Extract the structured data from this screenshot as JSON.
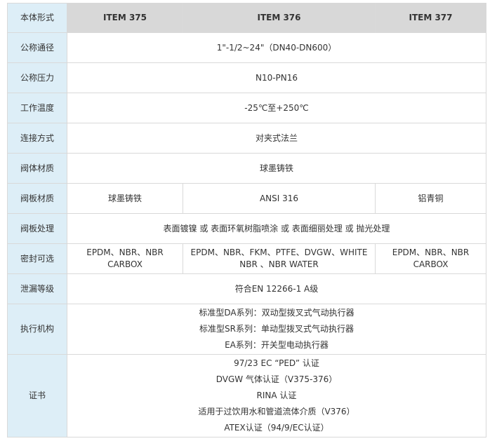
{
  "header": {
    "label": "本体形式",
    "items": [
      "ITEM 375",
      "ITEM 376",
      "ITEM 377"
    ]
  },
  "rows": {
    "size": {
      "label": "公称通径",
      "value": "1\"-1/2~24\"（DN40-DN600）"
    },
    "pressure": {
      "label": "公称压力",
      "value": "N10-PN16"
    },
    "temperature": {
      "label": "工作温度",
      "value": "-25℃至+250℃"
    },
    "connection": {
      "label": "连接方式",
      "value": "对夹式法兰"
    },
    "body_material": {
      "label": "阀体材质",
      "value": "球墨铸铁"
    },
    "disc_material": {
      "label": "阀板材质",
      "values": [
        "球墨铸铁",
        "ANSI 316",
        "铝青铜"
      ]
    },
    "disc_treatment": {
      "label": "阀板处理",
      "value": "表面镀镍 或 表面环氧树脂喷涂 或 表面细丽处理 或 抛光处理"
    },
    "seal_options": {
      "label": "密封可选",
      "values": [
        "EPDM、NBR、NBR CARBOX",
        "EPDM、NBR、FKM、PTFE、DVGW、WHITE NBR 、NBR WATER",
        "EPDM、NBR、NBR CARBOX"
      ]
    },
    "leakage": {
      "label": "泄漏等级",
      "value": "符合EN 12266-1 A级"
    },
    "actuator": {
      "label": "执行机构",
      "lines": [
        "标准型DA系列：双动型拨叉式气动执行器",
        "标准型SR系列：单动型拨叉式气动执行器",
        "EA系列：开关型电动执行器"
      ]
    },
    "certificates": {
      "label": "证书",
      "lines": [
        "97/23 EC “PED” 认证",
        "DVGW 气体认证（V375-376）",
        "RINA 认证",
        "适用于过饮用水和管道流体介质（V376）",
        "ATEX认证（94/9/EC认证）"
      ]
    }
  }
}
